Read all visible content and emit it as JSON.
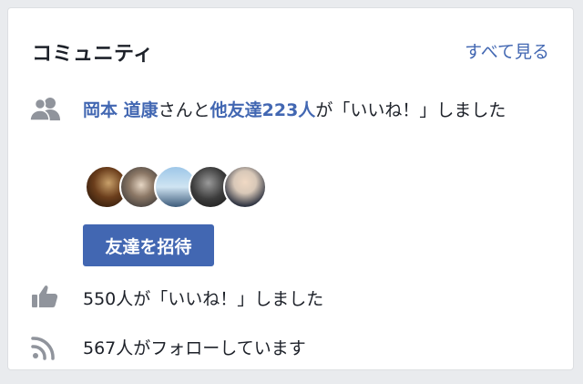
{
  "section": {
    "title": "コミュニティ",
    "see_all": "すべて見る"
  },
  "friends_like": {
    "friend_name": "岡本 道康",
    "connector": "さんと",
    "others_link": "他友達223人",
    "suffix": "が「いいね！」しました",
    "icon": "friends-icon"
  },
  "invite_button": {
    "label": "友達を招待"
  },
  "likes": {
    "text": "550人が「いいね！」しました",
    "icon": "thumbs-up-icon"
  },
  "followers": {
    "text": "567人がフォローしています",
    "icon": "rss-feed-icon"
  },
  "colors": {
    "link": "#4267b2",
    "text": "#1d2129",
    "icon": "#90949c",
    "background": "#e9ebee"
  }
}
